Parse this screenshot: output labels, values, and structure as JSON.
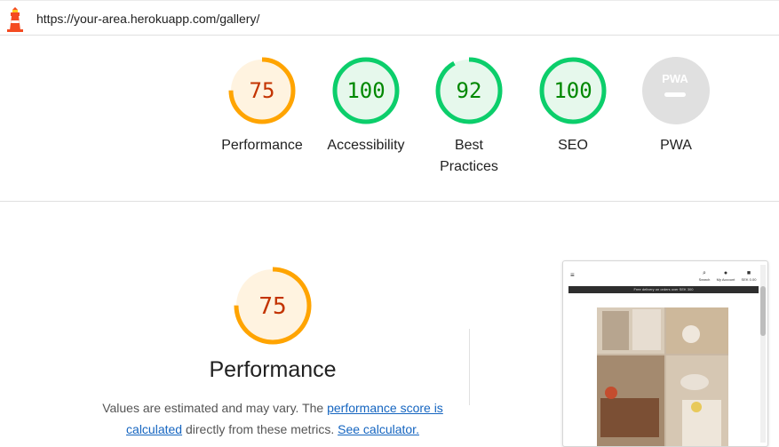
{
  "address_bar": {
    "url": "https://your-area.herokuapp.com/gallery/",
    "icon": "lighthouse-icon"
  },
  "categories": [
    {
      "label": "Performance",
      "score": "75",
      "fraction": 0.75,
      "status": "average"
    },
    {
      "label": "Accessibility",
      "score": "100",
      "fraction": 1.0,
      "status": "pass"
    },
    {
      "label_line1": "Best",
      "label_line2": "Practices",
      "score": "92",
      "fraction": 0.92,
      "status": "pass"
    },
    {
      "label": "SEO",
      "score": "100",
      "fraction": 1.0,
      "status": "pass"
    },
    {
      "label": "PWA",
      "badge_text": "PWA",
      "status": "na"
    }
  ],
  "performance": {
    "score": "75",
    "fraction": 0.75,
    "title": "Performance",
    "desc_part1": "Values are estimated and may vary. The ",
    "link1": "performance score is calculated",
    "desc_part2": " directly from these metrics. ",
    "link2": "See calculator."
  },
  "screenshot_preview": {
    "nav_search": "Search",
    "nav_account": "My Account",
    "nav_cart": "SEK 0.00",
    "banner": "Free delivery on orders over SEK 300"
  },
  "colors": {
    "average": "#ffa400",
    "average_text": "#c33300",
    "average_fill": "#fff3e0",
    "pass": "#0cce6b",
    "pass_text": "#008800",
    "pass_fill": "#e6f8ec",
    "na": "#e0e0e0",
    "link": "#1565c0"
  }
}
